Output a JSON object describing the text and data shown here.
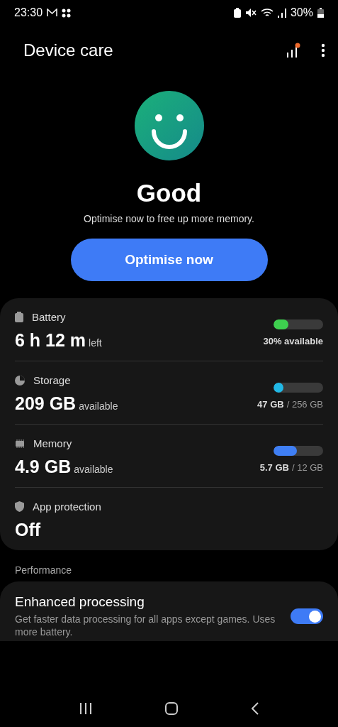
{
  "status_bar": {
    "time": "23:30",
    "battery": "30%"
  },
  "header": {
    "title": "Device care"
  },
  "status": {
    "title": "Good",
    "subtitle": "Optimise now to free up more memory.",
    "button": "Optimise now"
  },
  "items": [
    {
      "kind": "battery",
      "label": "Battery",
      "value": "6 h 12 m",
      "unit": "left",
      "level": 0.3,
      "color": "#3ecf4f",
      "detail": "30% available"
    },
    {
      "kind": "storage",
      "label": "Storage",
      "value": "209 GB",
      "unit": "available",
      "level": 0.18,
      "color": "#21b8e6",
      "used": "47 GB",
      "total": "/ 256 GB"
    },
    {
      "kind": "memory",
      "label": "Memory",
      "value": "4.9 GB",
      "unit": "available",
      "level": 0.47,
      "color": "#3f7ff5",
      "used": "5.7 GB",
      "total": "/ 12 GB"
    },
    {
      "kind": "protection",
      "label": "App protection",
      "value": "Off"
    }
  ],
  "performance": {
    "heading": "Performance",
    "title": "Enhanced processing",
    "description": "Get faster data processing for all apps except games. Uses more battery.",
    "on": true
  }
}
